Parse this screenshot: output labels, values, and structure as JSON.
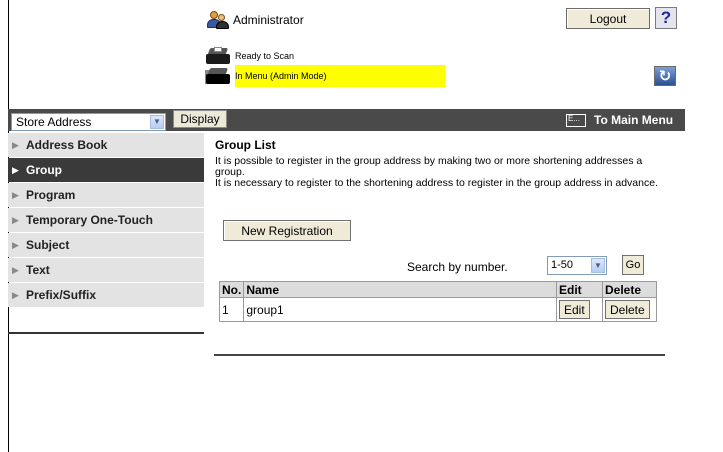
{
  "header": {
    "user_label": "Administrator",
    "logout_label": "Logout",
    "help_label": "?",
    "status_ready": "Ready to Scan",
    "status_mode": "In Menu (Admin Mode)",
    "refresh_icon": "refresh-icon"
  },
  "toolbar": {
    "store_select_value": "Store Address",
    "display_label": "Display",
    "main_menu_label": "To Main Menu"
  },
  "sidebar": {
    "items": [
      {
        "label": "Address Book",
        "active": false
      },
      {
        "label": "Group",
        "active": true
      },
      {
        "label": "Program",
        "active": false
      },
      {
        "label": "Temporary One-Touch",
        "active": false
      },
      {
        "label": "Subject",
        "active": false
      },
      {
        "label": "Text",
        "active": false
      },
      {
        "label": "Prefix/Suffix",
        "active": false
      }
    ]
  },
  "main": {
    "title": "Group List",
    "description_1": "It is possible to register in the group address by making two or more shortening addresses a group.",
    "description_2": "It is necessary to register to the shortening address to register in the group address in advance.",
    "new_registration_label": "New Registration",
    "search_label": "Search by number.",
    "range_value": "1-50",
    "go_label": "Go",
    "table": {
      "headers": [
        "No.",
        "Name",
        "Edit",
        "Delete"
      ],
      "rows": [
        {
          "no": "1",
          "name": "group1",
          "edit": "Edit",
          "delete": "Delete"
        }
      ]
    }
  },
  "colors": {
    "toolbar_bg": "#4a4a4a",
    "highlight": "#ffff00",
    "sidebar_active": "#3a3a3a",
    "sidebar_item": "#e3e3e3"
  }
}
